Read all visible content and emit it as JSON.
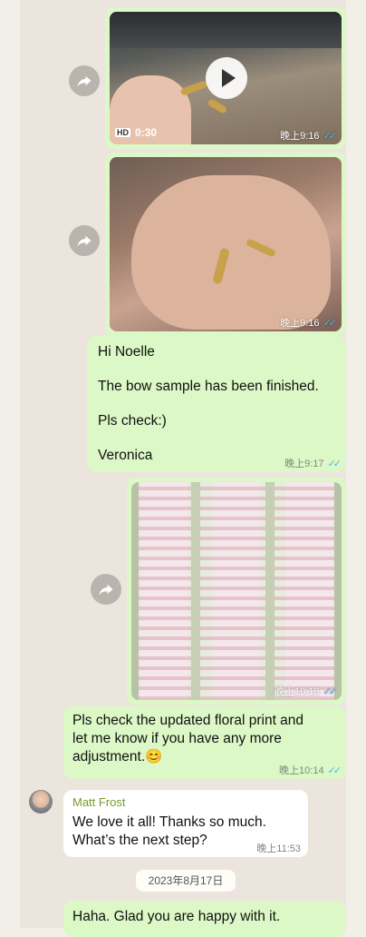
{
  "messages": {
    "video": {
      "duration": "0:30",
      "hd_label": "HD",
      "time": "晚上9:16",
      "ticks": "✓✓"
    },
    "photo1": {
      "time": "晚上9:16",
      "ticks": "✓✓"
    },
    "text1": {
      "line1": "Hi Noelle",
      "line2": "The bow sample has been finished.",
      "line3": "Pls check:)",
      "line4": "Veronica",
      "time": "晚上9:17",
      "ticks": "✓✓"
    },
    "photo2": {
      "time": "晚上10:13",
      "ticks": "✓✓"
    },
    "text2": {
      "line1": "Pls check the updated floral print and",
      "line2": "let me know if you have any more",
      "line3": "adjustment.",
      "emoji": "😊",
      "time": "晚上10:14",
      "ticks": "✓✓"
    },
    "incoming": {
      "sender": "Matt Frost",
      "line1": "We love it all! Thanks so much.",
      "line2": "What’s the next step?",
      "time": "晚上11:53"
    },
    "date_divider": "2023年8月17日",
    "text3": {
      "line1": "Haha. Glad you are happy with it."
    }
  },
  "icons": {
    "forward": "forward-arrow-icon",
    "play": "play-icon"
  },
  "colors": {
    "outgoing_bubble": "#dcf8c6",
    "incoming_bubble": "#ffffff",
    "chat_background": "#ece5dd",
    "read_ticks": "#4fb6ec",
    "sender_name": "#7a9b2a"
  }
}
